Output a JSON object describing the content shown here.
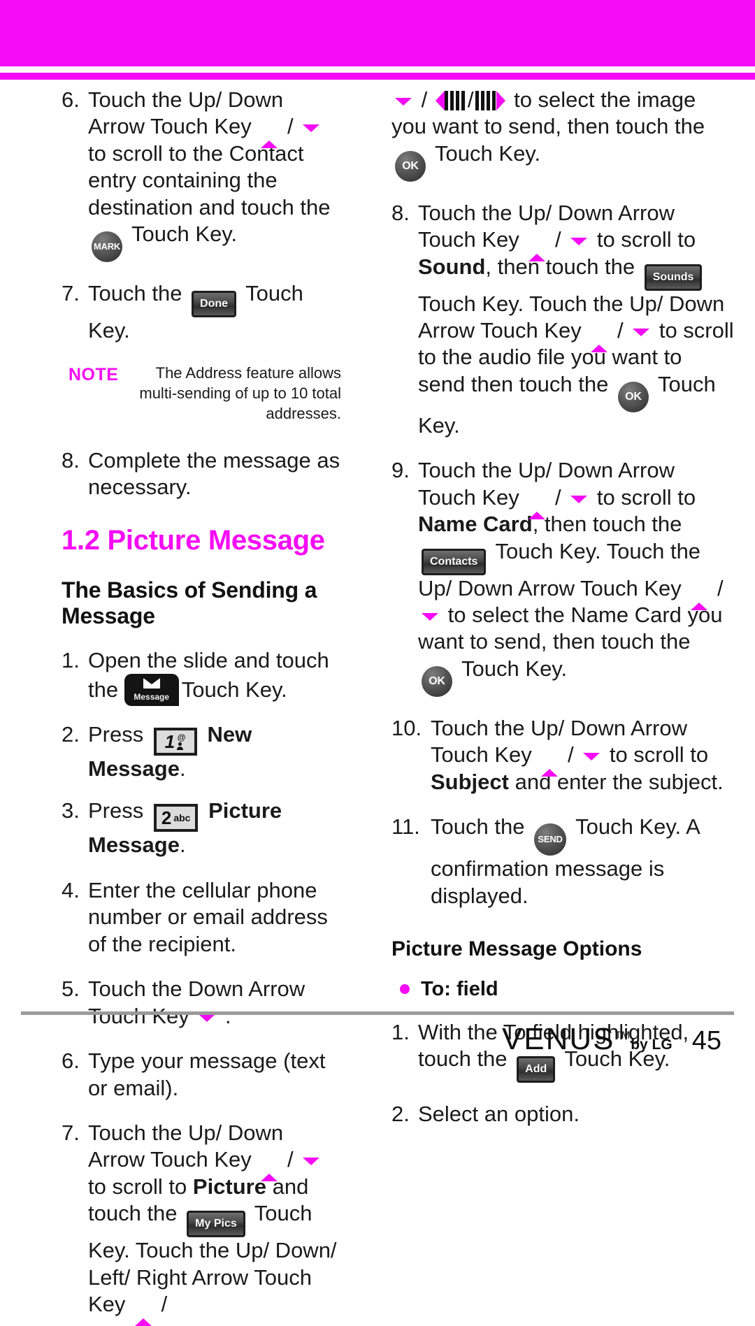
{
  "header": {
    "bar_color": "#f50bf5",
    "rule_color": "#f50bf5"
  },
  "left_column": {
    "step6": {
      "num": "6.",
      "t1": "Touch the Up/ Down Arrow Touch Key ",
      "t2": " / ",
      "t3": " to scroll to the Contact entry containing the destination and touch the ",
      "icon_mark": "MARK",
      "t4": " Touch Key."
    },
    "step7": {
      "num": "7.",
      "t1": "Touch the ",
      "icon_done": "Done",
      "t2": " Touch Key."
    },
    "note": {
      "label": "NOTE",
      "text": "The Address feature allows multi-sending of up to 10 total addresses."
    },
    "step8": {
      "num": "8.",
      "t1": "Complete the message as necessary."
    },
    "section_title": "1.2 Picture Message",
    "sub_title": "The Basics of Sending a Message",
    "basics": {
      "step1": {
        "num": "1.",
        "t1": "Open the slide and touch the ",
        "icon_message": "Message",
        "t2": "Touch Key."
      },
      "step2": {
        "num": "2.",
        "t1": "Press ",
        "key_digit": "1",
        "key_sub": "@",
        "t2": " ",
        "bold": "New Message",
        "t3": "."
      },
      "step3": {
        "num": "3.",
        "t1": "Press ",
        "key_digit": "2",
        "key_sub": "abc",
        "t2": " ",
        "bold": "Picture Message",
        "t3": "."
      },
      "step4": {
        "num": "4.",
        "t1": "Enter the cellular phone number or email address of the recipient."
      },
      "step5": {
        "num": "5.",
        "t1": "Touch the Down Arrow Touch Key ",
        "t2": " ."
      },
      "step6": {
        "num": "6.",
        "t1": "Type your message (text or email)."
      },
      "step7": {
        "num": "7.",
        "t1": "Touch the Up/ Down Arrow Touch Key ",
        "t2": " / ",
        "t3": " to scroll to ",
        "bold1": "Picture",
        "t4": " and touch the ",
        "icon_mypics": "My Pics",
        "t5": " Touch Key. Touch the Up/ Down/ Left/ Right Arrow Touch Key ",
        "t6": " /"
      }
    }
  },
  "right_column": {
    "step7_cont": {
      "t1": " / ",
      "t2": " to select the image you want to send, then touch the ",
      "icon_ok": "OK",
      "t3": " Touch Key."
    },
    "step8": {
      "num": "8.",
      "t1": "Touch the Up/ Down Arrow Touch Key ",
      "t2": " / ",
      "t3": " to scroll to ",
      "bold1": "Sound",
      "t4": ", then touch the ",
      "icon_sounds": "Sounds",
      "t5": " Touch Key. Touch the Up/ Down Arrow Touch Key ",
      "t6": " / ",
      "t7": " to scroll to the audio file you want to send then touch the ",
      "icon_ok": "OK",
      "t8": " Touch Key."
    },
    "step9": {
      "num": "9.",
      "t1": "Touch the Up/ Down Arrow Touch Key ",
      "t2": " / ",
      "t3": " to scroll to ",
      "bold1": "Name Card",
      "t4": ", then touch the ",
      "icon_contacts": "Contacts",
      "t5": " Touch Key. Touch the Up/ Down Arrow Touch Key ",
      "t6": " / ",
      "t7": " to select the Name Card you want to send, then touch the ",
      "icon_ok": "OK",
      "t8": " Touch Key."
    },
    "step10": {
      "num": "10.",
      "t1": "Touch the Up/ Down Arrow Touch Key ",
      "t2": " / ",
      "t3": " to scroll to ",
      "bold1": "Subject",
      "t4": " and enter the subject."
    },
    "step11": {
      "num": "11.",
      "t1": "Touch the ",
      "icon_send": "SEND",
      "t2": " Touch Key. A confirmation message is displayed."
    },
    "options_title": "Picture Message Options",
    "bullet_to_field": "To: field",
    "opt_step1": {
      "num": "1.",
      "t1": "With the To field highlighted, touch the ",
      "icon_add": "Add",
      "t2": " Touch Key."
    },
    "opt_step2": {
      "num": "2.",
      "t1": "Select an option."
    }
  },
  "footer": {
    "logo": "VENUS",
    "logo_tm": "TM",
    "logo_by": "by LG",
    "page_number": "45"
  }
}
